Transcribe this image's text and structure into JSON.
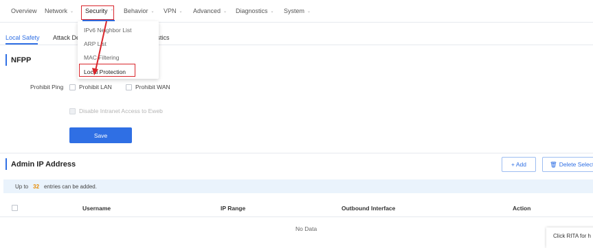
{
  "topnav": {
    "items": [
      {
        "label": "Overview"
      },
      {
        "label": "Network"
      },
      {
        "label": "Security"
      },
      {
        "label": "Behavior"
      },
      {
        "label": "VPN"
      },
      {
        "label": "Advanced"
      },
      {
        "label": "Diagnostics"
      },
      {
        "label": "System"
      }
    ]
  },
  "security_menu": {
    "items": [
      {
        "label": "IPv6 Neighbor List"
      },
      {
        "label": "ARP List"
      },
      {
        "label": "MAC Filtering"
      },
      {
        "label": "Local Protection"
      }
    ]
  },
  "subtabs": [
    {
      "label": "Local Safety"
    },
    {
      "label": "Attack Det"
    },
    {
      "label": "tistics"
    }
  ],
  "nfpp": {
    "title": "NFPP",
    "prohibit_ping_label": "Prohibit Ping",
    "prohibit_lan": "Prohibit LAN",
    "prohibit_wan": "Prohibit WAN",
    "disable_intranet": "Disable Intranet Access to Eweb",
    "save_label": "Save"
  },
  "admin_ip": {
    "title": "Admin IP Address",
    "add_label": "+ Add",
    "delete_label": "Delete Selecte",
    "info_prefix": "Up to",
    "info_count": "32",
    "info_suffix": "entries can be added.",
    "columns": [
      "Username",
      "IP Range",
      "Outbound Interface",
      "Action"
    ],
    "empty_text": "No Data"
  },
  "help_popup": "Click RITA for h",
  "colors": {
    "accent": "#2f6fe4",
    "annotation": "#d9242a",
    "info_bg": "#eaf3fc",
    "count": "#e68a00"
  }
}
